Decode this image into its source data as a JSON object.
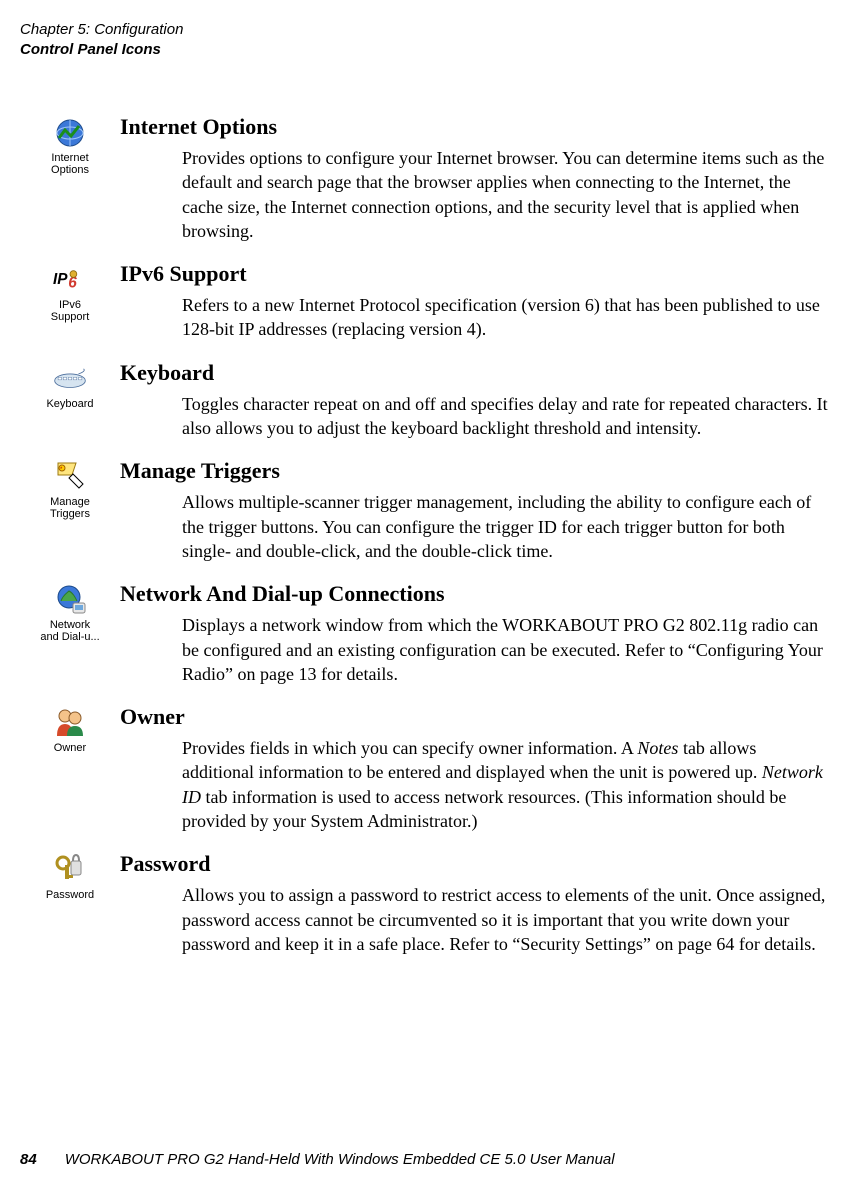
{
  "header": {
    "chapter": "Chapter 5: Configuration",
    "section_path": "Control Panel Icons"
  },
  "sections": {
    "internet_options": {
      "title": "Internet Options",
      "icon_name": "internet-options-icon",
      "icon_label": "Internet\nOptions",
      "body": "Provides options to configure your Internet browser. You can determine items such as the default and search page that the browser applies when connecting to the Internet, the cache size, the Internet connection options, and the security level that is applied when browsing."
    },
    "ipv6_support": {
      "title": "IPv6 Support",
      "icon_name": "ipv6-support-icon",
      "icon_label": "IPv6\nSupport",
      "body": "Refers to a new Internet Protocol specification (version 6) that has been published to use 128-bit IP addresses (replacing version 4)."
    },
    "keyboard": {
      "title": "Keyboard",
      "icon_name": "keyboard-icon",
      "icon_label": "Keyboard",
      "body": "Toggles character repeat on and off and specifies delay and rate for repeated characters. It also allows you to adjust the keyboard backlight threshold and intensity."
    },
    "manage_triggers": {
      "title": "Manage Triggers",
      "icon_name": "manage-triggers-icon",
      "icon_label": "Manage\nTriggers",
      "body": "Allows multiple-scanner trigger management, including the ability to configure each of the trigger buttons. You can configure the trigger ID for each trigger button for both single- and double-click, and the double-click time."
    },
    "network": {
      "title": "Network And Dial-up Connections",
      "icon_name": "network-icon",
      "icon_label": "Network\nand Dial-u...",
      "body": "Displays a network window from which the WORKABOUT PRO G2 802.11g radio can be configured and an existing configuration can be executed. Refer to “Configuring Your Radio” on page 13 for details."
    },
    "owner": {
      "title": "Owner",
      "icon_name": "owner-icon",
      "icon_label": "Owner",
      "body_pre": "Provides fields in which you can specify owner information. A ",
      "body_notes": "Notes",
      "body_mid": " tab allows additional information to be entered and displayed when the unit is powered up. ",
      "body_netid": "Network ID",
      "body_post": " tab information is used to access network resources. (This information should be provided by your System Administrator.)"
    },
    "password": {
      "title": "Password",
      "icon_name": "password-icon",
      "icon_label": "Password",
      "body": "Allows you to assign a password to restrict access to elements of the unit. Once assigned, password access cannot be circumvented so it is important that you write down your password and keep it in a safe place. Refer to “Security Settings” on page 64 for details."
    }
  },
  "footer": {
    "page_number": "84",
    "manual_title": "WORKABOUT PRO G2 Hand-Held With Windows Embedded CE 5.0 User Manual"
  }
}
